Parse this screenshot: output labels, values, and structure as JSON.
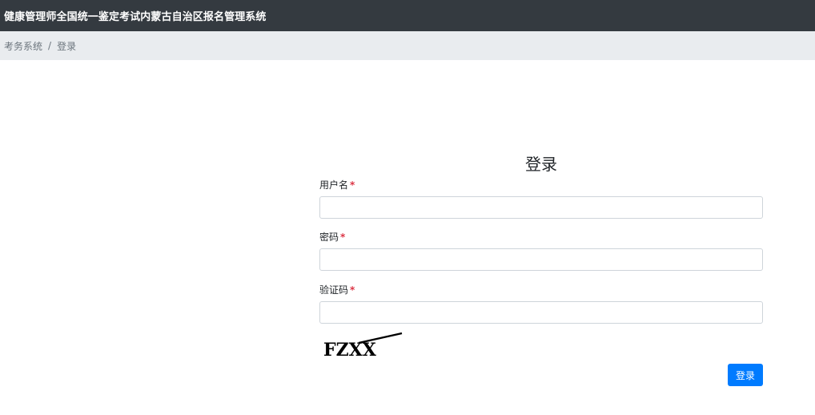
{
  "header": {
    "title": "健康管理师全国统一鉴定考试内蒙古自治区报名管理系统"
  },
  "breadcrumb": {
    "items": [
      "考务系统",
      "登录"
    ],
    "separator": "/"
  },
  "login": {
    "title": "登录",
    "required_mark": "*",
    "fields": [
      {
        "label": "用户名",
        "value": "",
        "placeholder": ""
      },
      {
        "label": "密码",
        "value": "",
        "placeholder": ""
      },
      {
        "label": "验证码",
        "value": "",
        "placeholder": ""
      }
    ],
    "captcha_text": "FZXX",
    "submit_label": "登录"
  },
  "colors": {
    "navbar": "#343a40",
    "breadcrumb_bg": "#e9ecef",
    "primary": "#007bff",
    "required": "#dc3545"
  }
}
